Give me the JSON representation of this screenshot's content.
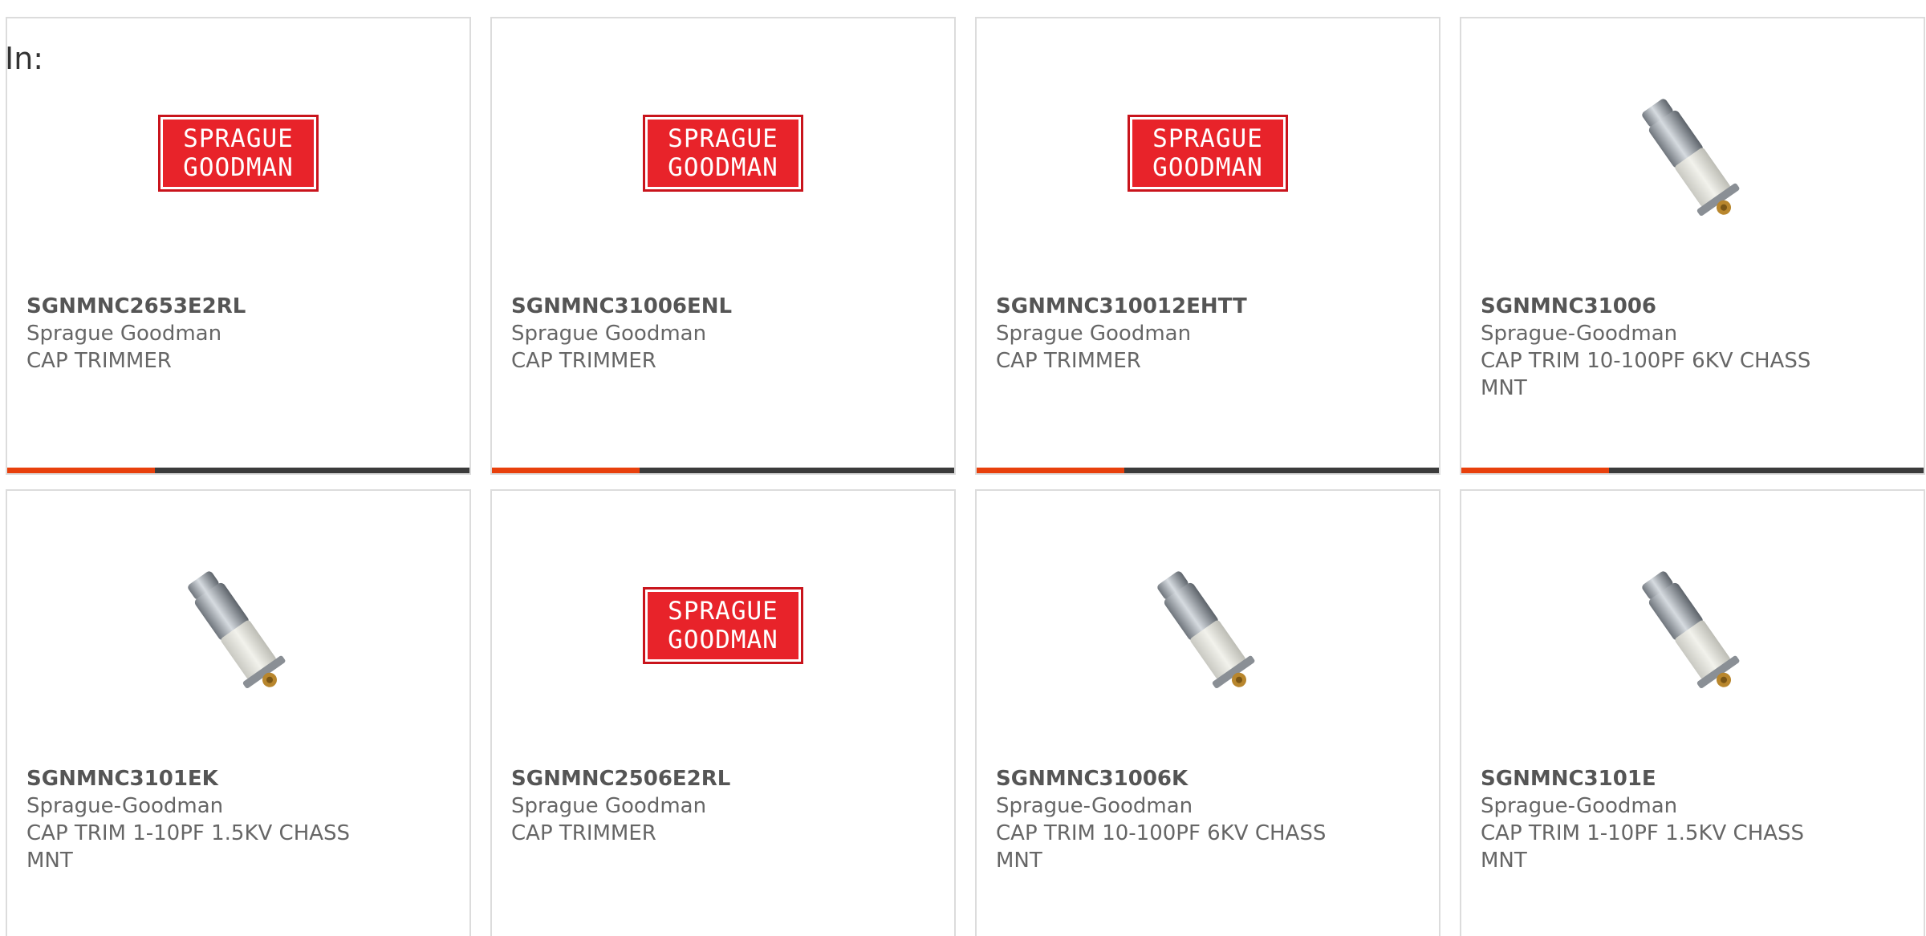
{
  "filter": {
    "in_label": "In:"
  },
  "colors": {
    "progress_accent": "#e8400c",
    "progress_track": "#3b3b3b",
    "logo_red": "#e8232a"
  },
  "cards": [
    {
      "part_number": "SGNMNC2653E2RL",
      "manufacturer": "Sprague Goodman",
      "description": "CAP TRIMMER",
      "image": "logo",
      "logo_lines": [
        "SPRAGUE",
        "GOODMAN"
      ],
      "progress": 0.32
    },
    {
      "part_number": "SGNMNC31006ENL",
      "manufacturer": "Sprague Goodman",
      "description": "CAP TRIMMER",
      "image": "logo",
      "logo_lines": [
        "SPRAGUE",
        "GOODMAN"
      ],
      "progress": 0.32
    },
    {
      "part_number": "SGNMNC310012EHTT",
      "manufacturer": "Sprague Goodman",
      "description": "CAP TRIMMER",
      "image": "logo",
      "logo_lines": [
        "SPRAGUE",
        "GOODMAN"
      ],
      "progress": 0.32
    },
    {
      "part_number": "SGNMNC31006",
      "manufacturer": "Sprague-Goodman",
      "description": "CAP TRIM 10-100PF 6KV CHASS MNT",
      "image": "trimmer-capacitor",
      "progress": 0.32
    },
    {
      "part_number": "SGNMNC3101EK",
      "manufacturer": "Sprague-Goodman",
      "description": "CAP TRIM 1-10PF 1.5KV CHASS MNT",
      "image": "trimmer-capacitor"
    },
    {
      "part_number": "SGNMNC2506E2RL",
      "manufacturer": "Sprague Goodman",
      "description": "CAP TRIMMER",
      "image": "logo",
      "logo_lines": [
        "SPRAGUE",
        "GOODMAN"
      ]
    },
    {
      "part_number": "SGNMNC31006K",
      "manufacturer": "Sprague-Goodman",
      "description": "CAP TRIM 10-100PF 6KV CHASS MNT",
      "image": "trimmer-capacitor"
    },
    {
      "part_number": "SGNMNC3101E",
      "manufacturer": "Sprague-Goodman",
      "description": "CAP TRIM 1-10PF 1.5KV CHASS MNT",
      "image": "trimmer-capacitor"
    }
  ]
}
